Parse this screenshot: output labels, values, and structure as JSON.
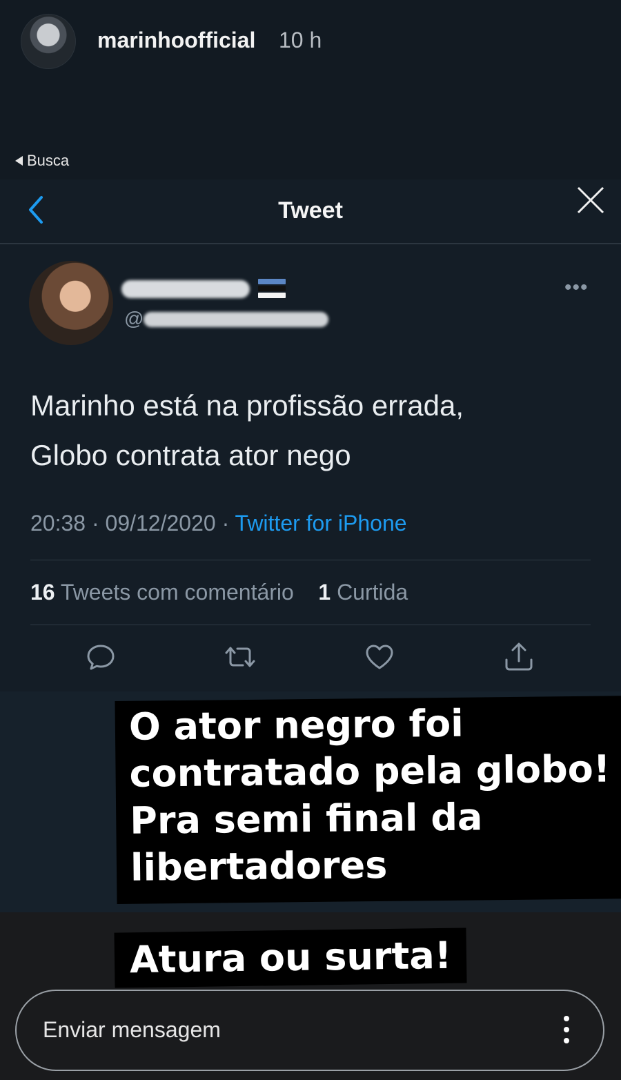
{
  "story": {
    "username": "marinhoofficial",
    "time": "10 h",
    "caption_lines": [
      "O ator negro foi",
      "contratado pela globo!",
      "Pra semi final da",
      "libertadores"
    ],
    "caption2": "Atura ou surta!",
    "message_placeholder": "Enviar mensagem"
  },
  "status_bar": {
    "back_label": "Busca"
  },
  "nav": {
    "title": "Tweet",
    "back_icon": "chevron-left-icon",
    "close_icon": "close-icon"
  },
  "tweet": {
    "handle_prefix": "@",
    "more_label": "•••",
    "text_lines": [
      "Marinho está na profissão errada,",
      "Globo contrata ator nego"
    ],
    "time": "20:38",
    "sep1": " · ",
    "date": "09/12/2020",
    "sep2": " · ",
    "source": "Twitter for iPhone",
    "quote_count": "16",
    "quote_label": "Tweets com comentário",
    "like_count": "1",
    "like_label": "Curtida"
  },
  "colors": {
    "twitter_blue": "#1d9bf0",
    "background": "#141d26",
    "muted": "#8b98a5"
  }
}
